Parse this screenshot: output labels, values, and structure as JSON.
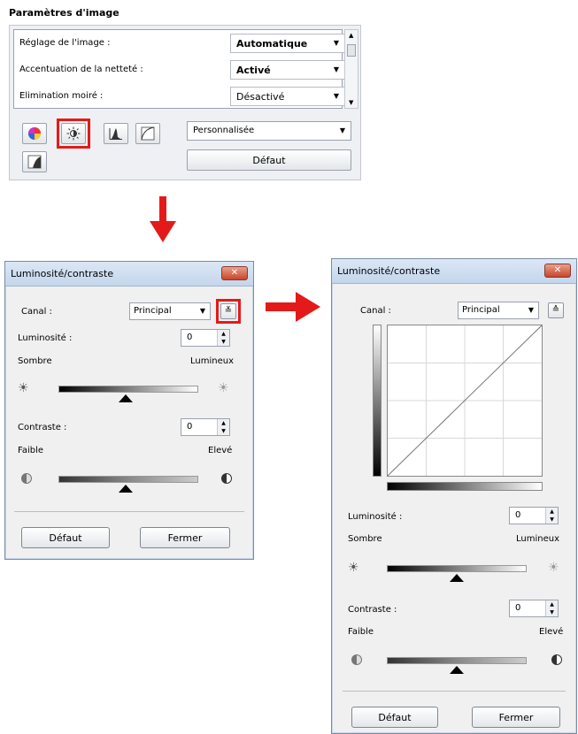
{
  "image_settings": {
    "title": "Paramètres d'image",
    "rows": [
      {
        "label": "Réglage de l'image :",
        "value": "Automatique"
      },
      {
        "label": "Accentuation de la netteté :",
        "value": "Activé"
      },
      {
        "label": "Elimination moiré :",
        "value": "Désactivé"
      }
    ],
    "mode_select": "Personnalisée",
    "default_button": "Défaut",
    "tool_icons": [
      "color-balance-icon",
      "brightness-contrast-icon",
      "histogram-icon",
      "tone-curve-icon",
      "threshold-icon"
    ]
  },
  "dialog_simple": {
    "title": "Luminosité/contraste",
    "close": "✕",
    "channel_label": "Canal :",
    "channel_value": "Principal",
    "brightness_label": "Luminosité :",
    "brightness_value": "0",
    "dark_label": "Sombre",
    "bright_label": "Lumineux",
    "contrast_label": "Contraste :",
    "contrast_value": "0",
    "low_label": "Faible",
    "high_label": "Elevé",
    "default_button": "Défaut",
    "close_button": "Fermer"
  },
  "dialog_expanded": {
    "title": "Luminosité/contraste",
    "close": "✕",
    "channel_label": "Canal :",
    "channel_value": "Principal",
    "brightness_label": "Luminosité :",
    "brightness_value": "0",
    "dark_label": "Sombre",
    "bright_label": "Lumineux",
    "contrast_label": "Contraste :",
    "contrast_value": "0",
    "low_label": "Faible",
    "high_label": "Elevé",
    "default_button": "Défaut",
    "close_button": "Fermer"
  },
  "colors": {
    "highlight": "#e41a1a",
    "arrow": "#e41a1a"
  }
}
